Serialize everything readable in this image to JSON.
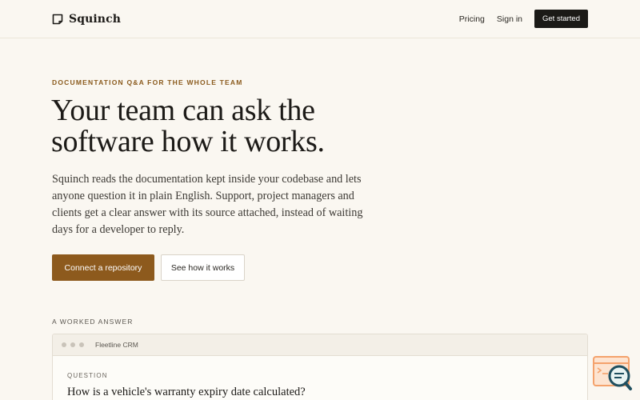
{
  "header": {
    "brand_name": "Squinch",
    "brand_icon": "document-icon",
    "nav": {
      "pricing": "Pricing",
      "sign_in": "Sign in",
      "cta": "Get started"
    }
  },
  "hero": {
    "eyebrow": "DOCUMENTATION Q&A FOR THE WHOLE TEAM",
    "headline_lines": [
      "Your team can ask the",
      "software how it works."
    ],
    "lede_lines": [
      "Squinch reads the documentation kept inside your codebase and lets",
      "anyone question it in plain English. Support, project managers and",
      "clients get a clear answer with its source attached, instead of waiting",
      "days for a developer to reply."
    ],
    "primary_button": "Connect a repository",
    "secondary_button": "See how it works"
  },
  "worked_answer": {
    "section_label": "A WORKED ANSWER",
    "window_title": "Fleetline CRM",
    "question_label": "QUESTION",
    "question_text": "How is a vehicle's warranty expiry date calculated?"
  },
  "widget": {
    "icon": "search-chat-icon"
  },
  "colors": {
    "background": "#faf7f1",
    "accent": "#8d5a1d",
    "dark": "#1b1a17",
    "eyebrow": "#8a5a1c",
    "widget_orange": "#f4a26c",
    "widget_teal": "#1f4f5f"
  }
}
